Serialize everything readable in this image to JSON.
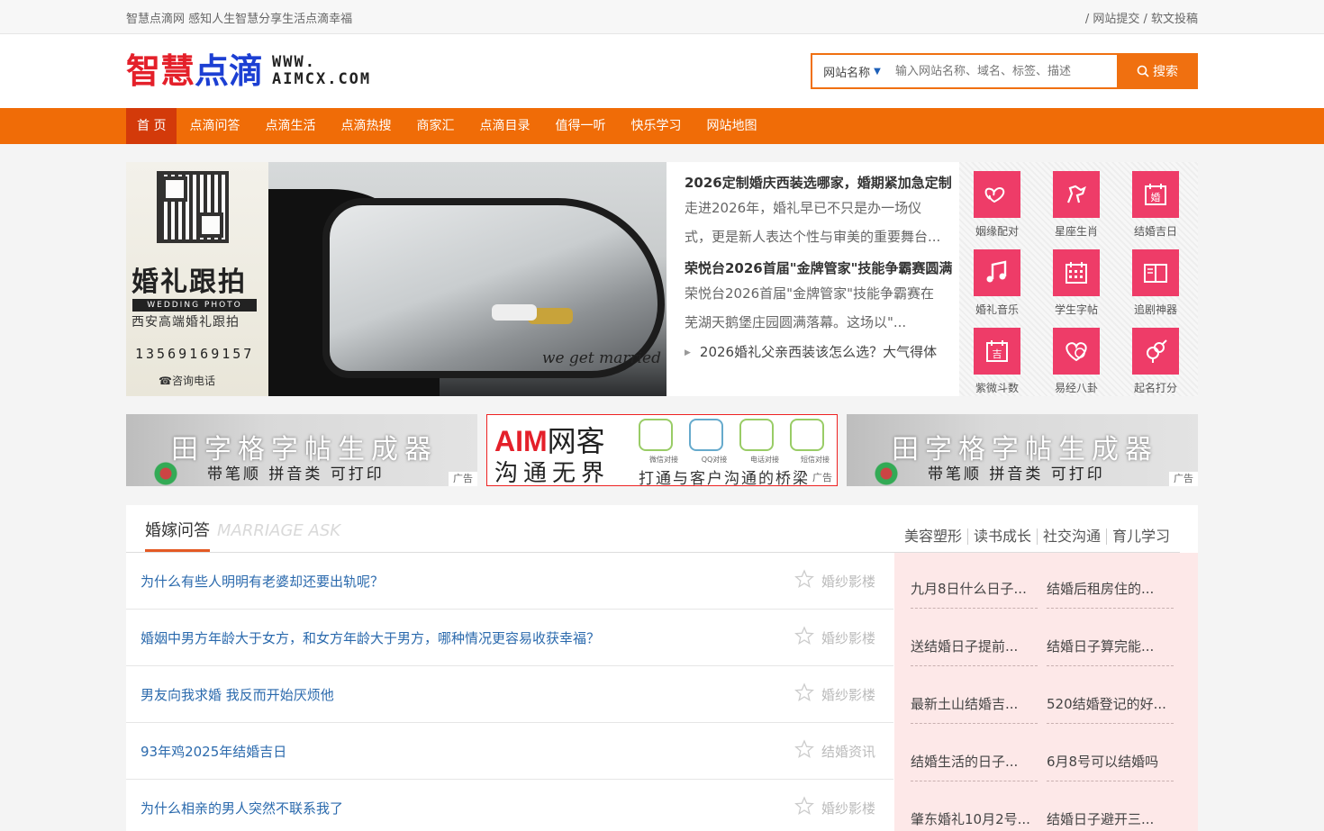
{
  "topbar": {
    "slogan": "智慧点滴网 感知人生智慧分享生活点滴幸福",
    "links": "/ 网站提交 / 软文投稿"
  },
  "logo": {
    "cn_part1": "智慧",
    "cn_part2": "点滴",
    "en_line1": "WWW.",
    "en_line2": "AIMCX.COM"
  },
  "search": {
    "select_value": "网站名称",
    "placeholder": "输入网站名称、域名、标签、描述",
    "button_label": "搜索"
  },
  "nav": [
    {
      "label": "首 页",
      "active": true
    },
    {
      "label": "点滴问答"
    },
    {
      "label": "点滴生活"
    },
    {
      "label": "点滴热搜"
    },
    {
      "label": "商家汇"
    },
    {
      "label": "点滴目录"
    },
    {
      "label": "值得一听"
    },
    {
      "label": "快乐学习"
    },
    {
      "label": "网站地图"
    }
  ],
  "poster": {
    "title": "婚礼跟拍",
    "subtitle_en": "WEDDING PHOTO",
    "subtitle_cn": "西安高端婚礼跟拍",
    "phone": "13569169157",
    "consult": "☎咨询电话"
  },
  "photo": {
    "script": "we get married"
  },
  "news": {
    "headline1": "2026定制婚庆西装选哪家，婚期紧加急定制",
    "summary1": "走进2026年，婚礼早已不只是办一场仪式，更是新人表达个性与审美的重要舞台...",
    "headline2": "荣悦台2026首届\"金牌管家\"技能争霸赛圆满",
    "summary2": "荣悦台2026首届\"金牌管家\"技能争霸赛在芜湖天鹅堡庄园圆满落幕。这场以\"...",
    "bullet": "2026婚礼父亲西装该怎么选？大气得体"
  },
  "tools": [
    {
      "label": "姻缘配对",
      "icon": "hearts-icon"
    },
    {
      "label": "星座生肖",
      "icon": "horse-icon"
    },
    {
      "label": "结婚吉日",
      "icon": "calendar-wedding-icon"
    },
    {
      "label": "婚礼音乐",
      "icon": "music-note-icon"
    },
    {
      "label": "学生字帖",
      "icon": "grid-calendar-icon"
    },
    {
      "label": "追剧神器",
      "icon": "book-icon"
    },
    {
      "label": "紫微斗数",
      "icon": "calendar-ji-icon"
    },
    {
      "label": "易经八卦",
      "icon": "yinyang-heart-icon"
    },
    {
      "label": "起名打分",
      "icon": "gender-icon"
    }
  ],
  "ads": {
    "side_big": "田字格字帖生成器",
    "side_small": "带笔顺 拼音类 可打印",
    "tag": "广告",
    "mid_brand_a": "AIM",
    "mid_brand_b": "网客",
    "mid_slogan": "沟通无界",
    "mid_caps": [
      "微信对接",
      "QQ对接",
      "电话对接",
      "短信对接"
    ],
    "mid_bottom": "打通与客户沟通的桥梁"
  },
  "section": {
    "title": "婚嫁问答",
    "title_en": "MARRIAGE ASK",
    "tabs": [
      "美容塑形",
      "读书成长",
      "社交沟通",
      "育儿学习"
    ],
    "questions": [
      {
        "q": "为什么有些人明明有老婆却还要出轨呢？",
        "cat": "婚纱影楼"
      },
      {
        "q": "婚姻中男方年龄大于女方，和女方年龄大于男方，哪种情况更容易收获幸福？",
        "cat": "婚纱影楼"
      },
      {
        "q": "男友向我求婚 我反而开始厌烦他",
        "cat": "婚纱影楼"
      },
      {
        "q": "93年鸡2025年结婚吉日",
        "cat": "结婚资讯"
      },
      {
        "q": "为什么相亲的男人突然不联系我了",
        "cat": "婚纱影楼"
      }
    ],
    "panel": [
      "九月8日什么日子...",
      "结婚后租房住的...",
      "送结婚日子提前...",
      "结婚日子算完能...",
      "最新土山结婚吉...",
      "520结婚登记的好...",
      "结婚生活的日子...",
      "6月8号可以结婚吗",
      "肇东婚礼10月2号...",
      "结婚日子避开三..."
    ]
  }
}
